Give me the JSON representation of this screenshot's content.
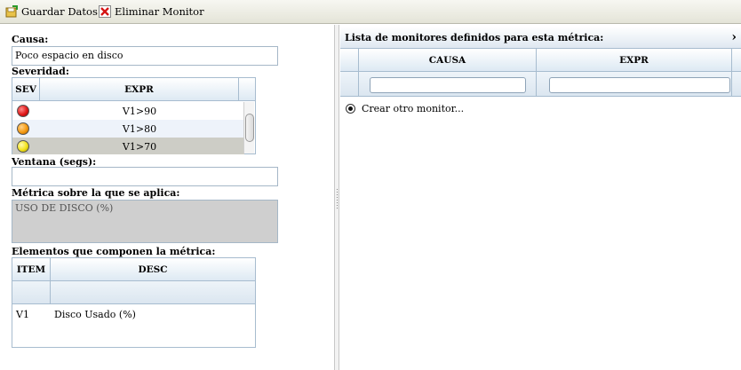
{
  "toolbar": {
    "save_label": "Guardar Datos",
    "save_icon": "save-disk-icon",
    "delete_label": "Eliminar Monitor",
    "delete_icon": "delete-red-x-icon"
  },
  "form": {
    "causa_label": "Causa:",
    "causa_value": "Poco espacio en disco",
    "severidad_label": "Severidad:",
    "severity_grid": {
      "columns": [
        "SEV",
        "EXPR"
      ],
      "rows": [
        {
          "color": "#e01818",
          "expr": "V1>90"
        },
        {
          "color": "#f59a10",
          "expr": "V1>80"
        },
        {
          "color": "#f2e21a",
          "expr": "V1>70"
        }
      ]
    },
    "ventana_label": "Ventana (segs):",
    "ventana_value": "",
    "metrica_label": "Métrica sobre la que se aplica:",
    "metrica_value": "USO DE DISCO (%)",
    "elementos_label": "Elementos que componen la métrica:",
    "elements_grid": {
      "columns": [
        "ITEM",
        "DESC"
      ],
      "rows": [
        {
          "item": "V1",
          "desc": "Disco Usado (%)"
        }
      ]
    }
  },
  "right_panel": {
    "title": "Lista de monitores definidos para esta métrica:",
    "columns": [
      "CAUSA",
      "EXPR"
    ],
    "create_option": "Crear otro monitor..."
  },
  "colors": {
    "selected_row": "#cdcdc6",
    "alt_row": "#eef3fa",
    "grid_border": "#a7bccf"
  }
}
